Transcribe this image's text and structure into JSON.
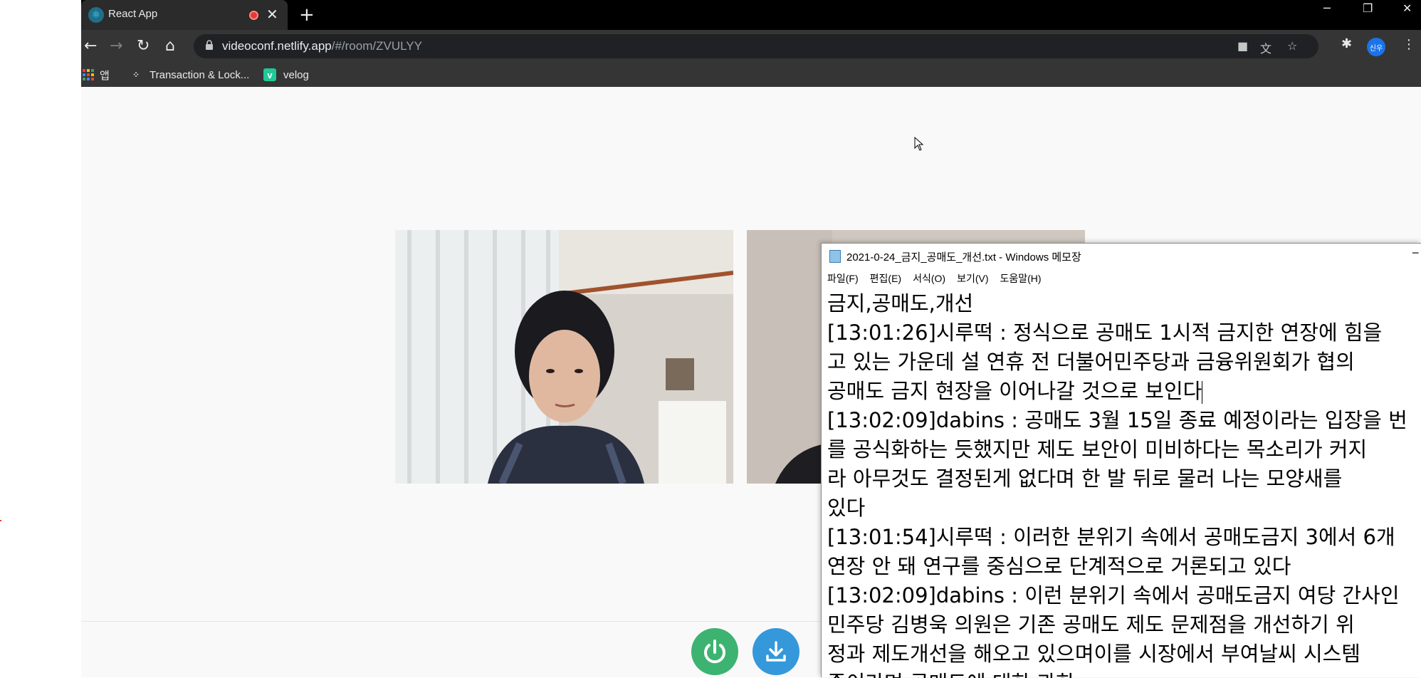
{
  "browser": {
    "tab": {
      "title": "React App"
    },
    "address": {
      "domain": "videoconf.netlify.app",
      "path": "/#/room/ZVULYY"
    },
    "bookmarks": [
      {
        "label": "앱"
      },
      {
        "label": "Transaction & Lock..."
      },
      {
        "label": "velog"
      }
    ],
    "profile_label": "신우"
  },
  "notepad": {
    "title": "2021-0-24_금지_공매도_개선.txt - Windows 메모장",
    "menu": [
      "파일(F)",
      "편집(E)",
      "서식(O)",
      "보기(V)",
      "도움말(H)"
    ],
    "lines": [
      "금지,공매도,개선",
      "[13:01:26]시루떡 : 정식으로 공매도 1시적 금지한 연장에 힘을",
      "고 있는 가운데 설 연휴 전 더불어민주당과 금융위원회가 협의",
      "공매도 금지 현장을 이어나갈 것으로 보인다",
      "[13:02:09]dabins : 공매도 3월 15일 종료 예정이라는 입장을 번",
      "를 공식화하는 듯했지만 제도 보안이 미비하다는 목소리가 커지",
      "라 아무것도 결정된게 없다며 한 발 뒤로 물러 나는 모양새를 ",
      "있다",
      "[13:01:54]시루떡 : 이러한 분위기 속에서 공매도금지 3에서 6개",
      "연장 안 돼 연구를 중심으로 단계적으로 거론되고 있다",
      "[13:02:09]dabins : 이런 분위기 속에서 공매도금지 여당 간사인",
      "민주당 김병욱 의원은 기존 공매도 제도 문제점을 개선하기 위",
      "정과 제도개선을 해오고 있으며이를 시장에서 부여날씨 시스템",
      "중이라며 공매도에 대한 과한"
    ]
  },
  "controls": {
    "power_color": "#3cb371",
    "download_color": "#3498db"
  }
}
